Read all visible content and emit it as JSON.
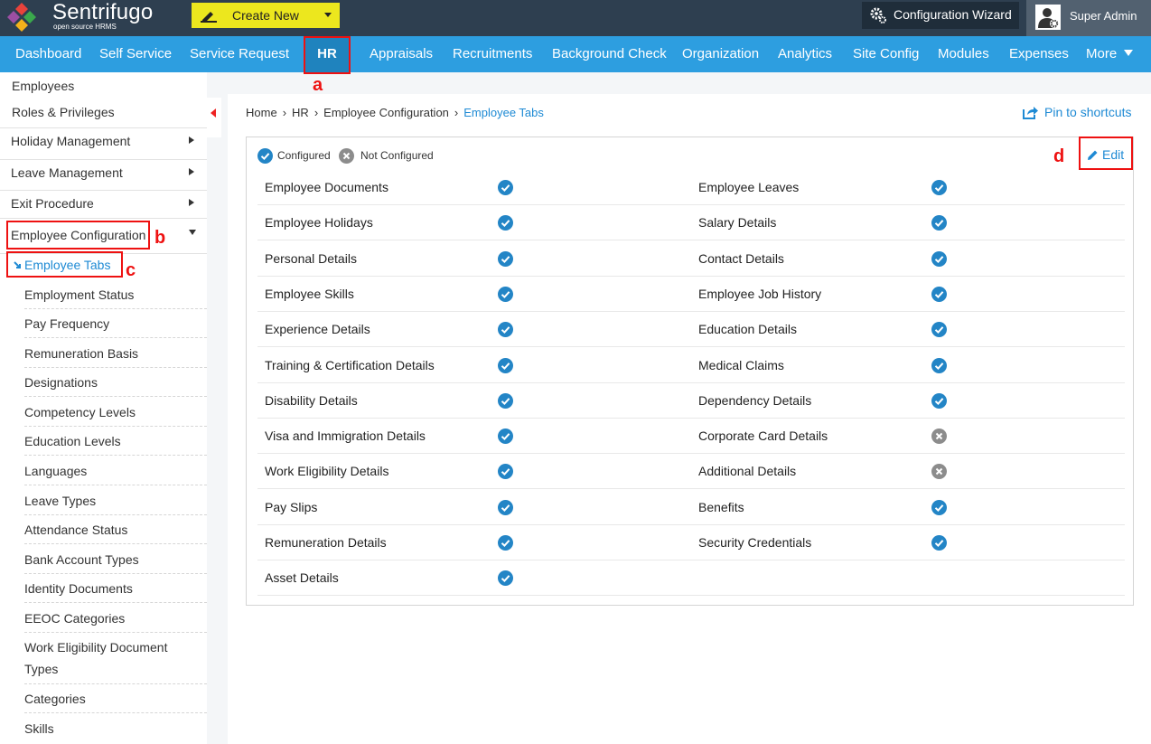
{
  "app": {
    "logo_name": "Sentrifugo",
    "logo_tagline": "open source HRMS",
    "create_new": "Create New",
    "config_wizard": "Configuration Wizard",
    "user": "Super Admin"
  },
  "nav": {
    "items": [
      "Dashboard",
      "Self Service",
      "Service Request",
      "HR",
      "Appraisals",
      "Recruitments",
      "Background Check",
      "Organization",
      "Analytics",
      "Site Config",
      "Modules",
      "Expenses",
      "More"
    ],
    "active": "HR"
  },
  "annotations": {
    "a": "a",
    "b": "b",
    "c": "c",
    "d": "d"
  },
  "sidebar": {
    "items": [
      "Employees",
      "Roles & Privileges",
      "Holiday Management",
      "Leave Management",
      "Exit Procedure",
      "Employee Configuration"
    ],
    "sub_items": [
      "Employee Tabs",
      "Employment Status",
      "Pay Frequency",
      "Remuneration Basis",
      "Designations",
      "Competency Levels",
      "Education Levels",
      "Languages",
      "Leave Types",
      "Attendance Status",
      "Bank Account Types",
      "Identity Documents",
      "EEOC Categories",
      "Work Eligibility Document",
      "Types",
      "Categories",
      "Skills"
    ]
  },
  "breadcrumb": [
    "Home",
    "HR",
    "Employee Configuration",
    "Employee Tabs"
  ],
  "breadcrumb_sep": "›",
  "pin_label": "Pin to shortcuts",
  "legend": {
    "configured": "Configured",
    "not_configured": "Not Configured"
  },
  "edit_label": "Edit",
  "tabs_left": [
    {
      "name": "Employee Documents",
      "status": "configured"
    },
    {
      "name": "Employee Holidays",
      "status": "configured"
    },
    {
      "name": "Personal Details",
      "status": "configured"
    },
    {
      "name": "Employee Skills",
      "status": "configured"
    },
    {
      "name": "Experience Details",
      "status": "configured"
    },
    {
      "name": "Training & Certification Details",
      "status": "configured"
    },
    {
      "name": "Disability Details",
      "status": "configured"
    },
    {
      "name": "Visa and Immigration Details",
      "status": "configured"
    },
    {
      "name": "Work Eligibility Details",
      "status": "configured"
    },
    {
      "name": "Pay Slips",
      "status": "configured"
    },
    {
      "name": "Remuneration Details",
      "status": "configured"
    },
    {
      "name": "Asset Details",
      "status": "configured"
    }
  ],
  "tabs_right": [
    {
      "name": "Employee Leaves",
      "status": "configured"
    },
    {
      "name": "Salary Details",
      "status": "configured"
    },
    {
      "name": "Contact Details",
      "status": "configured"
    },
    {
      "name": "Employee Job History",
      "status": "configured"
    },
    {
      "name": "Education Details",
      "status": "configured"
    },
    {
      "name": "Medical Claims",
      "status": "configured"
    },
    {
      "name": "Dependency Details",
      "status": "configured"
    },
    {
      "name": "Corporate Card Details",
      "status": "not_configured"
    },
    {
      "name": "Additional Details",
      "status": "not_configured"
    },
    {
      "name": "Benefits",
      "status": "configured"
    },
    {
      "name": "Security Credentials",
      "status": "configured"
    }
  ],
  "colors": {
    "topbar": "#2e3f50",
    "nav": "#2d9ee0",
    "accent": "#1e8ad4",
    "configured": "#2385c6",
    "not_configured": "#8c8c8c",
    "annotation": "#e11111"
  }
}
